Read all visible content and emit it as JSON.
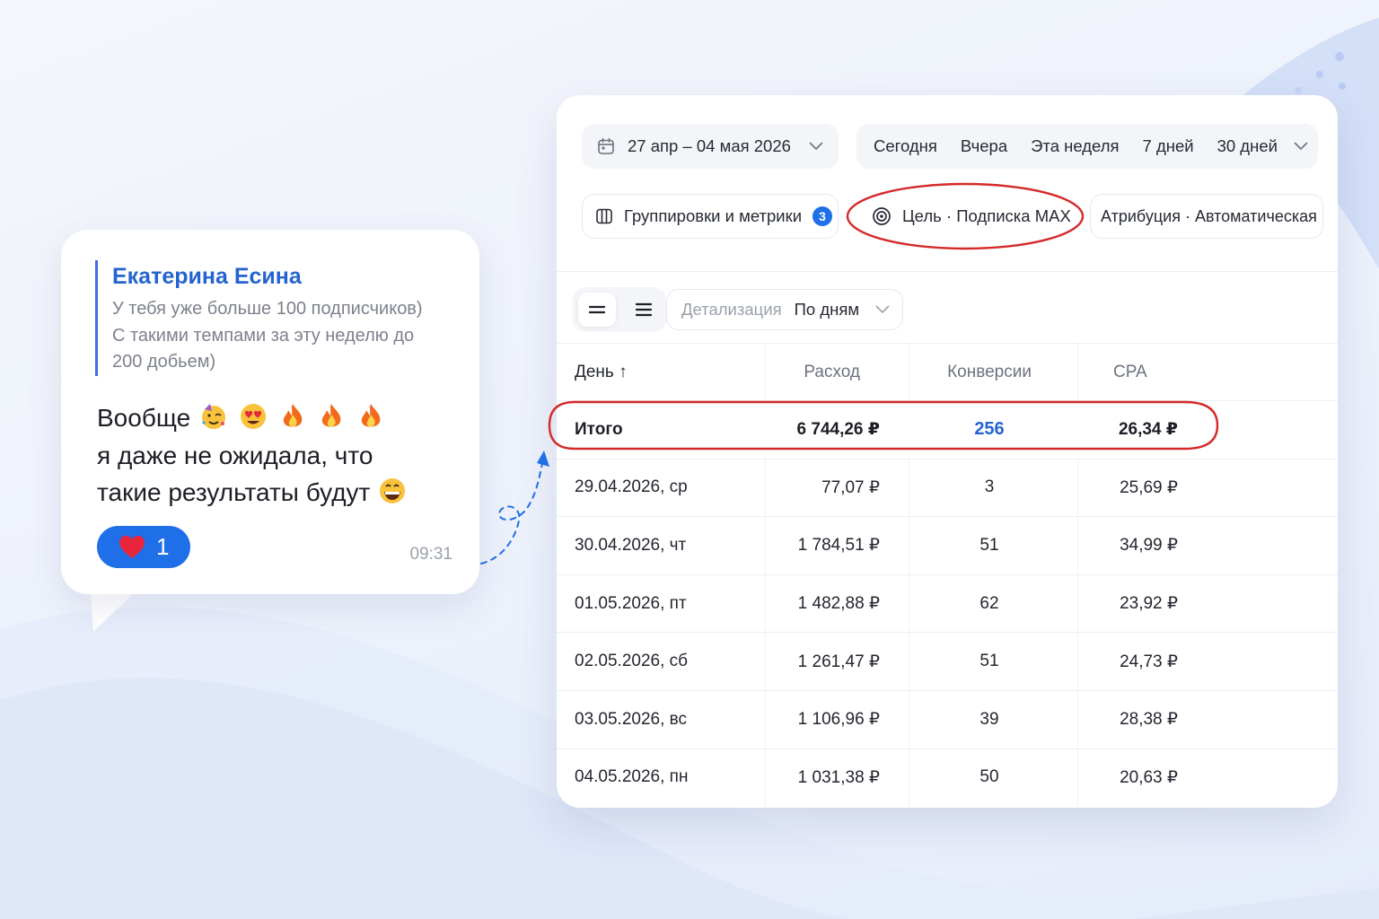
{
  "colors": {
    "accent_blue": "#1f6fe8",
    "highlight_red": "#d42a2a",
    "author_blue": "#2563d0"
  },
  "chat": {
    "author": "Екатерина Есина",
    "quote_lines": [
      "У тебя уже больше 100 подписчиков)",
      "С такими темпами за эту неделю до",
      "200 добьем)"
    ],
    "message_lines": [
      "Вообще",
      "я даже не ожидала, что",
      "такие результаты будут"
    ],
    "emoji_names": [
      "party-face",
      "heart-eyes",
      "fire",
      "fire",
      "fire",
      "grinning-face"
    ],
    "reaction": {
      "icon": "heart-icon",
      "count": "1"
    },
    "time": "09:31"
  },
  "toolbar": {
    "date_range": "27 апр – 04 мая 2026",
    "periods": [
      "Сегодня",
      "Вчера",
      "Эта неделя",
      "7 дней",
      "30 дней"
    ],
    "groupings_label": "Группировки и метрики",
    "groupings_badge": "3",
    "goal_label": "Цель · Подписка MAX",
    "attribution_label": "Атрибуция · Автоматическая",
    "detail_label": "Детализация",
    "detail_value": "По дням"
  },
  "table": {
    "columns": [
      "День ↑",
      "Расход",
      "Конверсии",
      "CPA"
    ],
    "total": {
      "day": "Итого",
      "spend": "6 744,26 ₽",
      "conversions": "256",
      "cpa": "26,34 ₽"
    },
    "rows": [
      {
        "day": "29.04.2026, ср",
        "spend": "77,07 ₽",
        "conversions": "3",
        "cpa": "25,69 ₽"
      },
      {
        "day": "30.04.2026, чт",
        "spend": "1 784,51 ₽",
        "conversions": "51",
        "cpa": "34,99 ₽"
      },
      {
        "day": "01.05.2026, пт",
        "spend": "1 482,88 ₽",
        "conversions": "62",
        "cpa": "23,92 ₽"
      },
      {
        "day": "02.05.2026, сб",
        "spend": "1 261,47 ₽",
        "conversions": "51",
        "cpa": "24,73 ₽"
      },
      {
        "day": "03.05.2026, вс",
        "spend": "1 106,96 ₽",
        "conversions": "39",
        "cpa": "28,38 ₽"
      },
      {
        "day": "04.05.2026, пн",
        "spend": "1 031,38 ₽",
        "conversions": "50",
        "cpa": "20,63 ₽"
      }
    ]
  }
}
